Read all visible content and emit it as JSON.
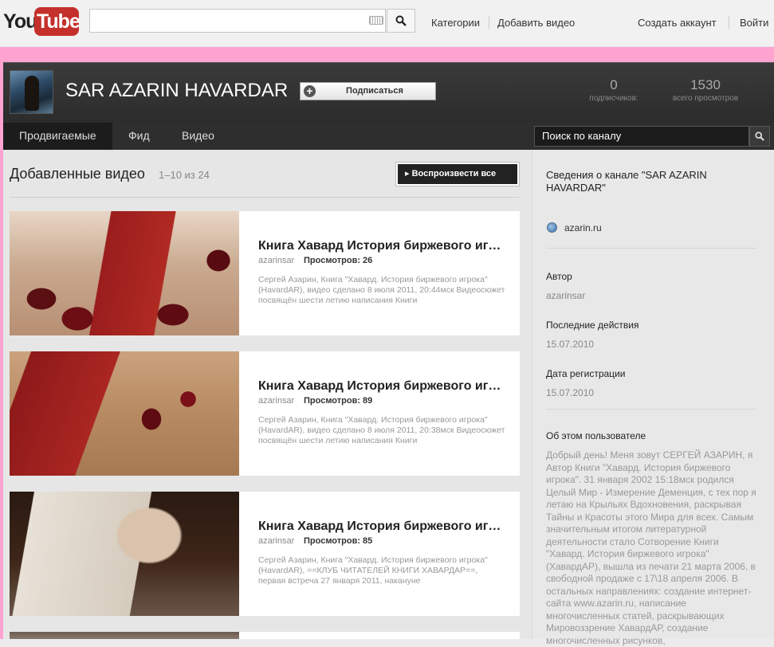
{
  "masthead": {
    "logo_you": "You",
    "logo_tube": "Tube",
    "nav_categories": "Категории",
    "nav_upload": "Добавить видео",
    "nav_create_account": "Создать аккаунт",
    "nav_sign_in": "Войти"
  },
  "channel": {
    "name": "SAR AZARIN HAVARDAR",
    "subscribe_label": "Подписаться",
    "subscribers_count": "0",
    "subscribers_label": "подписчиков:",
    "views_count": "1530",
    "views_label": "всего просмотров"
  },
  "tabs": {
    "featured": "Продвигаемые",
    "feed": "Фид",
    "videos": "Видео"
  },
  "channel_search": {
    "placeholder": "Поиск по каналу"
  },
  "videos_section": {
    "title": "Добавленные видео",
    "count": "1–10 из 24",
    "play_all": "Воспроизвести все",
    "items": [
      {
        "title": "Книга Хавард История биржевого игрока",
        "author": "azarinsar",
        "views": "Просмотров: 26",
        "desc": "Сергей Азарин, Книга \"Хавард. История биржевого игрока\" (HavardAR), видео сделано 8 июля 2011, 20:44мск Видеосюжет посвящён шести летию написания Книги"
      },
      {
        "title": "Книга Хавард История биржевого игрока",
        "author": "azarinsar",
        "views": "Просмотров: 89",
        "desc": "Сергей Азарин, Книга \"Хавард. История биржевого игрока\" (HavardAR), видео сделано 8 июля 2011, 20:38мск Видеосюжет посвящён шести летию написания Книги"
      },
      {
        "title": "Книга Хавард История биржевого игрока",
        "author": "azarinsar",
        "views": "Просмотров: 85",
        "desc": "Сергей Азарин, Книга \"Хавард. История биржевого игрока\" (HavardAR), ==КЛУБ ЧИТАТЕЛЕЙ КНИГИ ХАВАРДАР==, первая встреча 27 января 2011, накануне"
      }
    ]
  },
  "sidebar": {
    "title": "Сведения о канале \"SAR AZARIN HAVARDAR\"",
    "website": "azarin.ru",
    "author_label": "Автор",
    "author_value": "azarinsar",
    "last_activity_label": "Последние действия",
    "last_activity_value": "15.07.2010",
    "joined_label": "Дата регистрации",
    "joined_value": "15.07.2010",
    "about_label": "Об этом пользователе",
    "about_text": "Добрый день! Меня зовут СЕРГЕЙ АЗАРИН, я Автор Книги \"Хавард. История биржевого игрока\". 31 января 2002 15:18мск родился Целый Мир - Измерение Деменция, с тех пор я летаю на Крыльях Вдохновения, раскрывая Тайны и Красоты этого Мира для всех. Самым значительным итогом литературной деятельности стало Сотворение Книги \"Хавард. История биржевого игрока\" (ХавардАР), вышла из печати 21 марта 2006, в свободной продаже с 17\\18 апреля 2006. В остальных направлениях: создание интернет-сайта www.azarin.ru, написание многочисленных статей, раскрывающих Мировоззрение ХавардАР, создание многочисленных рисунков,"
  }
}
